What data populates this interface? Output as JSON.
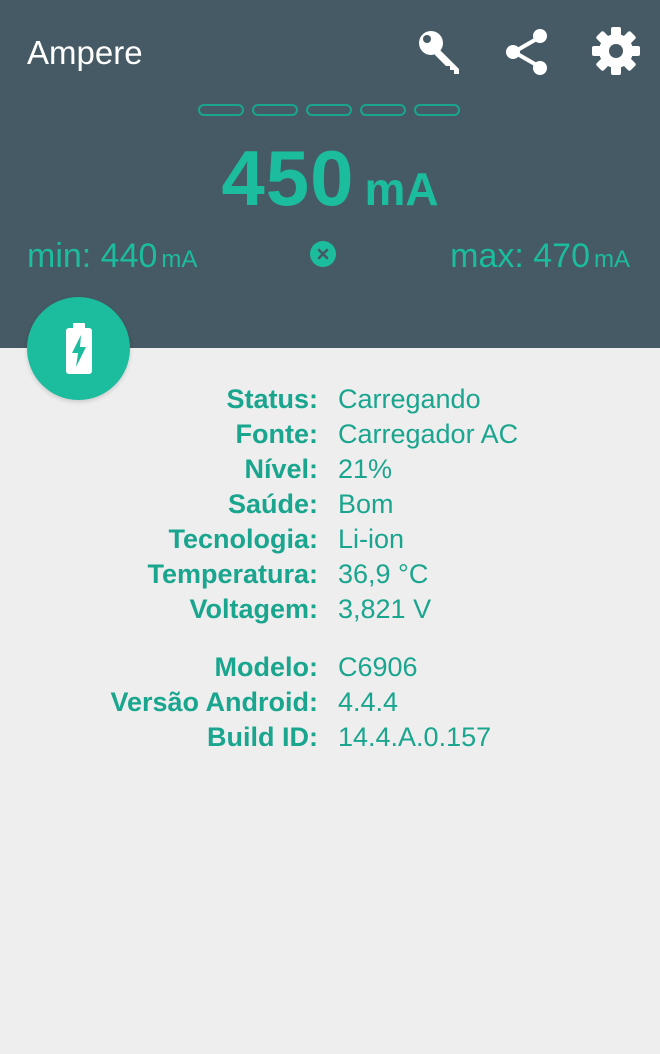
{
  "app": {
    "title": "Ampere"
  },
  "toolbar": {
    "icons": [
      "key-icon",
      "share-icon",
      "settings-icon"
    ]
  },
  "reading": {
    "value": "450",
    "unit": "mA",
    "min_label": "min: 440",
    "min_unit": "mA",
    "max_label": "max: 470",
    "max_unit": "mA"
  },
  "colors": {
    "header_bg": "#455a64",
    "accent": "#1cbc9e",
    "text_accent": "#1aa58f",
    "body_bg": "#eeeeee"
  },
  "battery": {
    "rows": [
      {
        "key": "Status:",
        "value": "Carregando"
      },
      {
        "key": "Fonte:",
        "value": "Carregador AC"
      },
      {
        "key": "Nível:",
        "value": "21%"
      },
      {
        "key": "Saúde:",
        "value": "Bom"
      },
      {
        "key": "Tecnologia:",
        "value": "Li-ion"
      },
      {
        "key": "Temperatura:",
        "value": "36,9 °C"
      },
      {
        "key": "Voltagem:",
        "value": "3,821 V"
      }
    ]
  },
  "device": {
    "rows": [
      {
        "key": "Modelo:",
        "value": "C6906"
      },
      {
        "key": "Versão Android:",
        "value": "4.4.4"
      },
      {
        "key": "Build ID:",
        "value": "14.4.A.0.157"
      }
    ]
  }
}
